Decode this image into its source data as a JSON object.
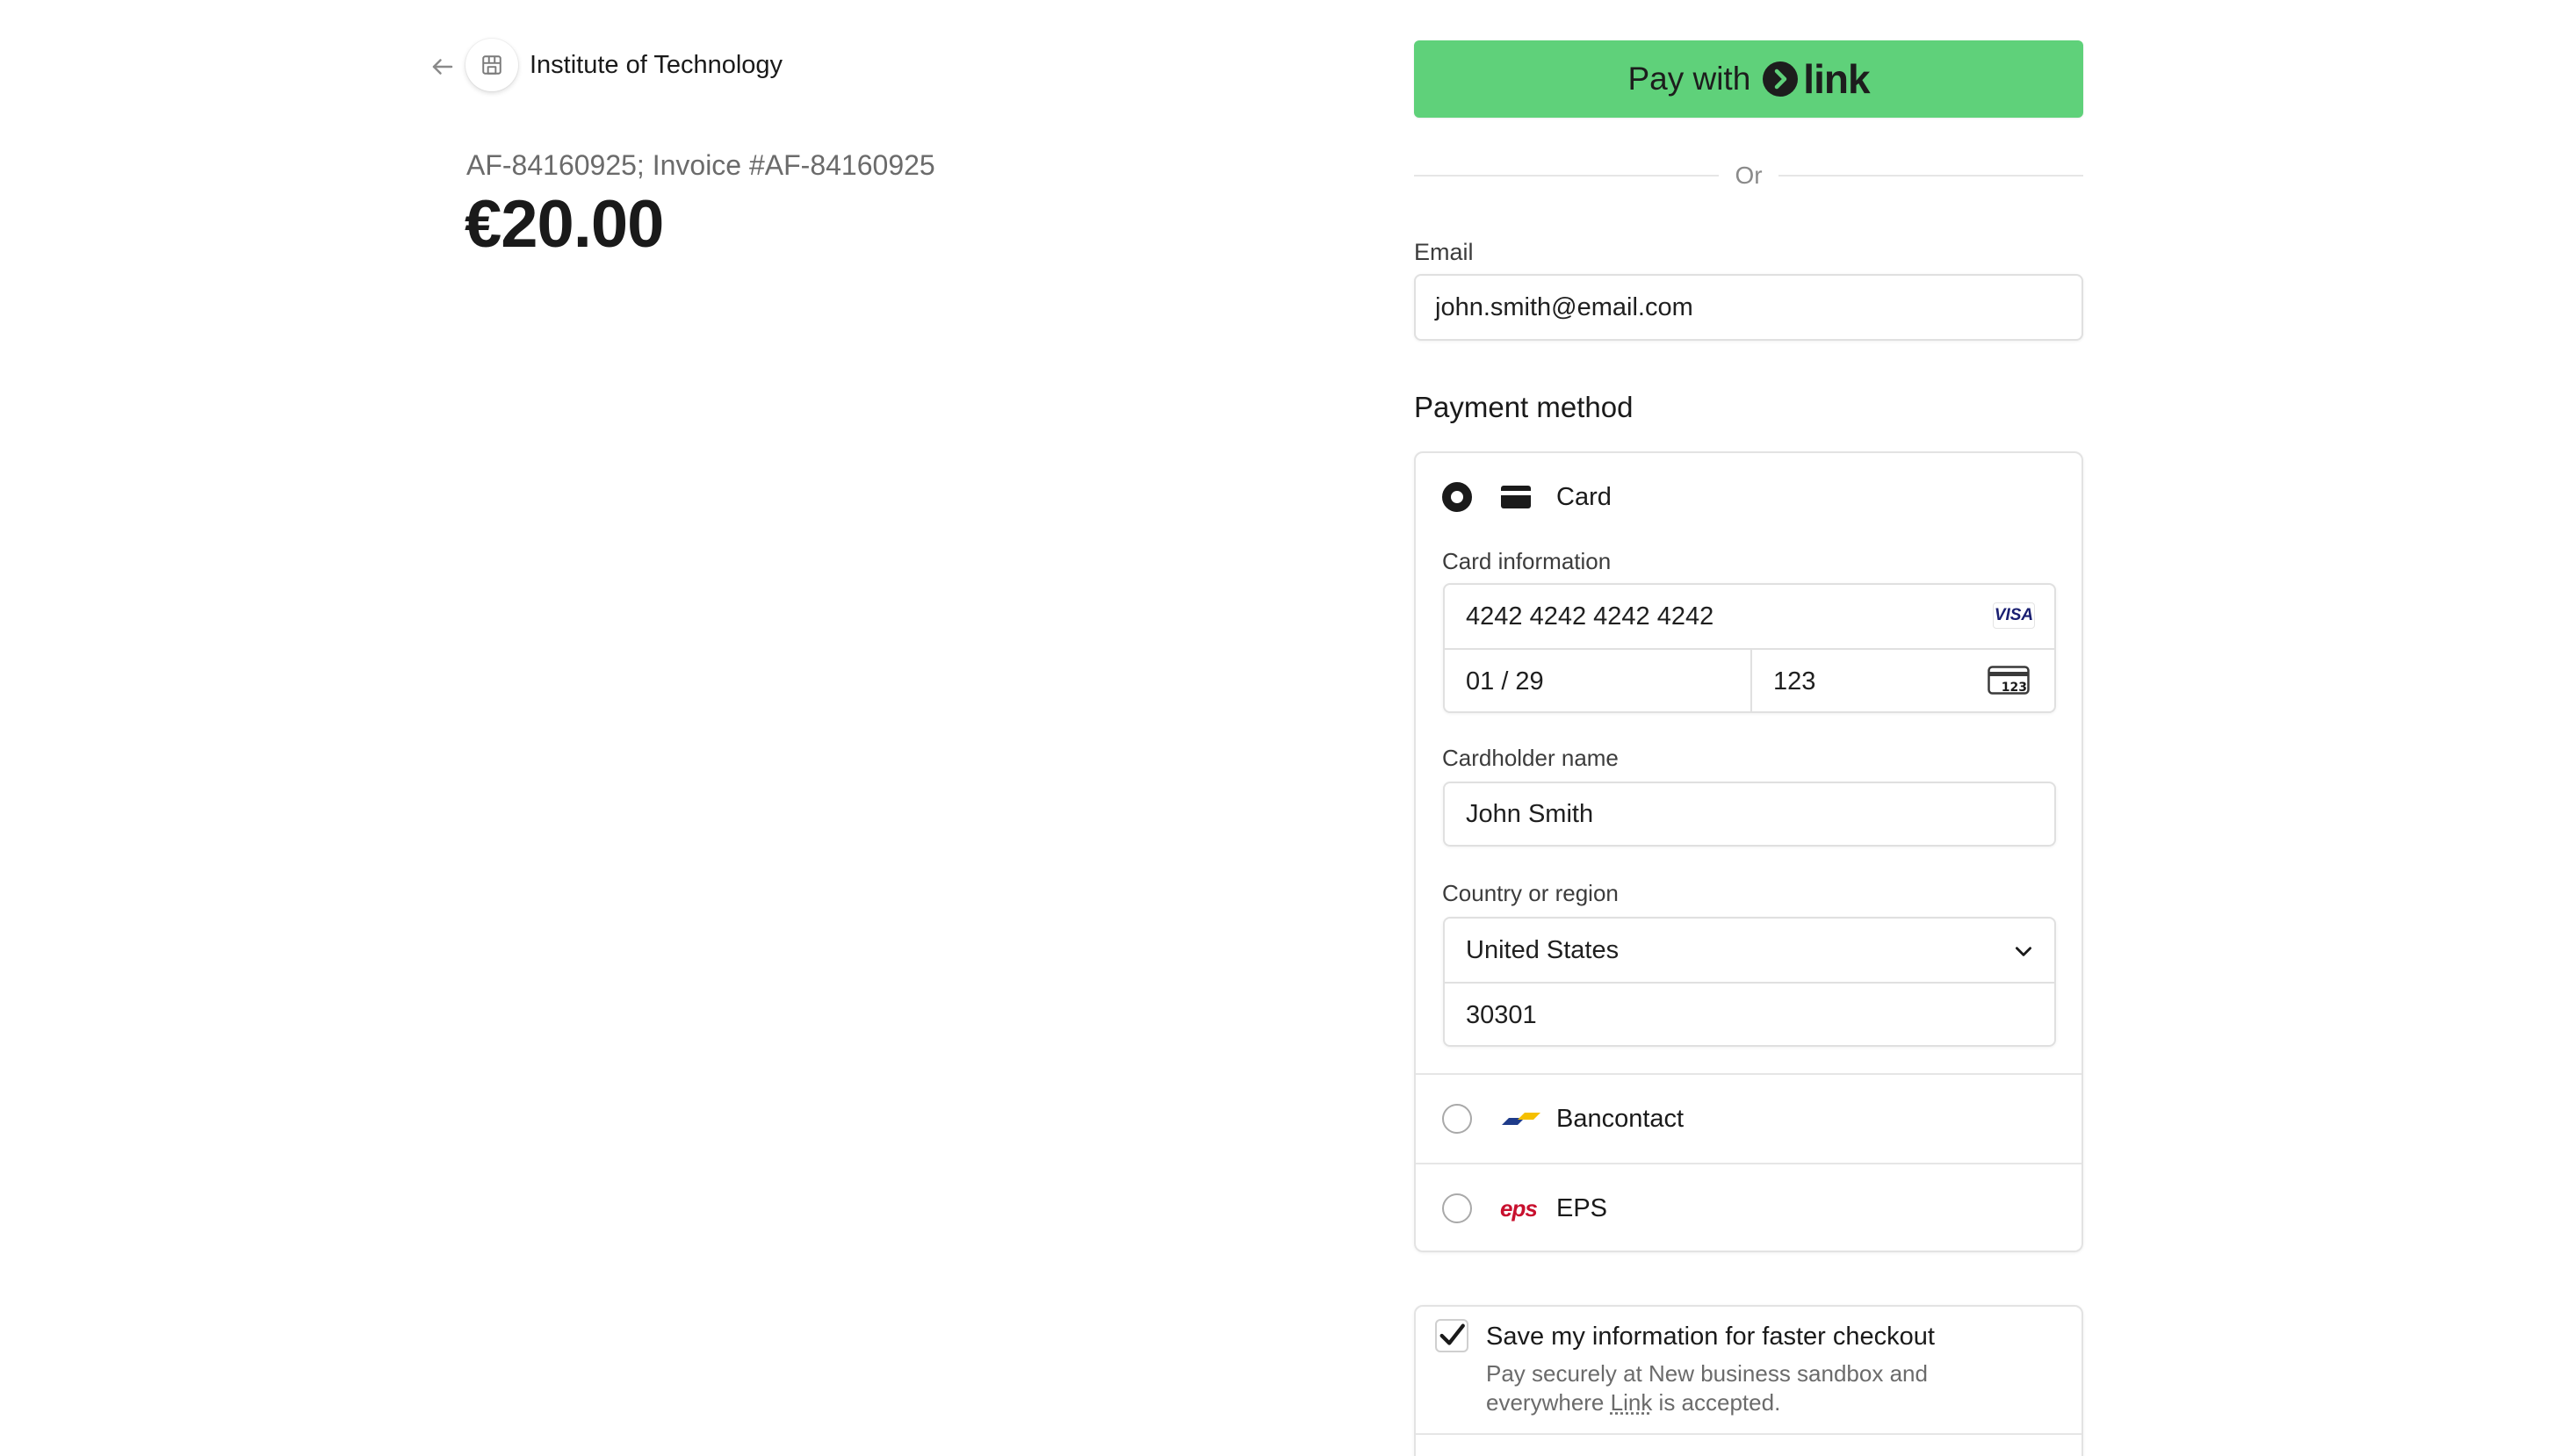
{
  "merchant": {
    "name": "Institute of Technology"
  },
  "invoice": {
    "description": "AF-84160925; Invoice #AF-84160925",
    "amount": "€20.00"
  },
  "link_button": {
    "pay_with": "Pay with",
    "brand": "link"
  },
  "divider": {
    "or": "Or"
  },
  "email": {
    "label": "Email",
    "value": "john.smith@email.com"
  },
  "payment_method": {
    "title": "Payment method",
    "card": {
      "label": "Card",
      "card_info_label": "Card information",
      "number": "4242 4242 4242 4242",
      "brand_badge": "VISA",
      "expiry": "01 / 29",
      "cvc": "123",
      "cvc_icon_text": "123",
      "cardholder_label": "Cardholder name",
      "cardholder_value": "John Smith",
      "country_label": "Country or region",
      "country_value": "United States",
      "postal_value": "30301"
    },
    "bancontact": {
      "label": "Bancontact"
    },
    "eps": {
      "label": "EPS",
      "logo_text": "eps"
    }
  },
  "save_info": {
    "title": "Save my information for faster checkout",
    "desc_prefix": "Pay securely at New business sandbox and everywhere ",
    "desc_link": "Link",
    "desc_suffix": " is accepted."
  },
  "colors": {
    "link_green": "#5fd17a",
    "visa_blue": "#1a1f71",
    "bancontact_blue": "#1e3b8a",
    "bancontact_yellow": "#f5c000",
    "eps_red": "#c8102e"
  }
}
